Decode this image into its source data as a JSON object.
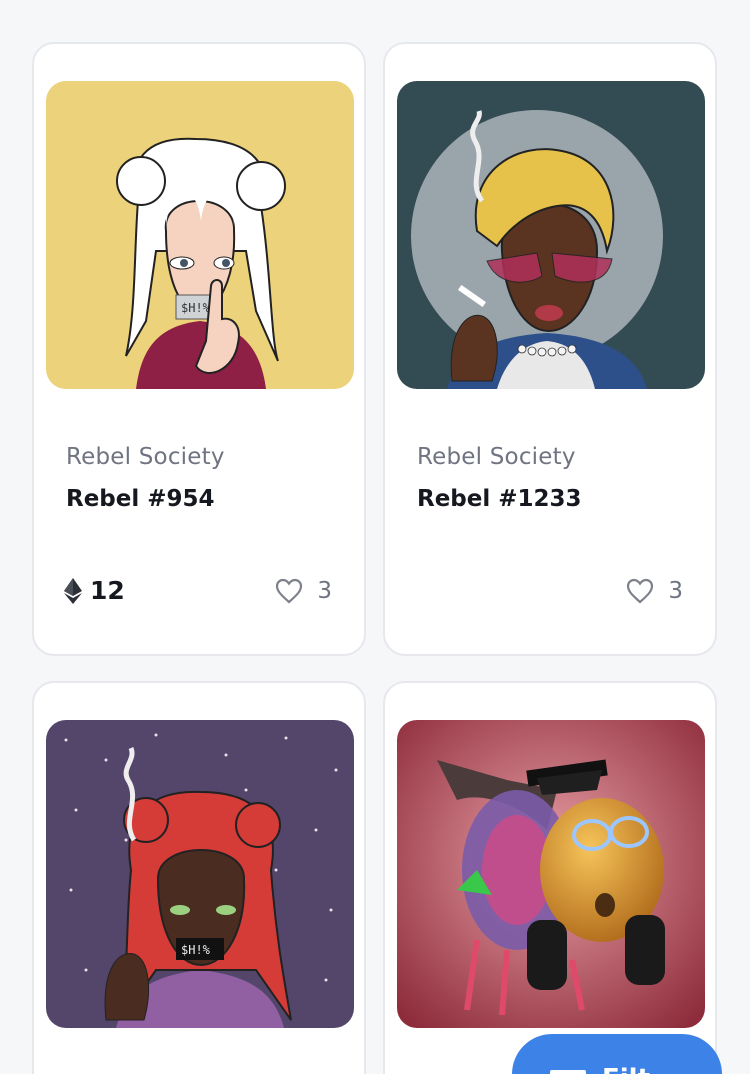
{
  "cards": [
    {
      "collection": "Rebel Society",
      "title": "Rebel #954",
      "price": "12",
      "likes": "3",
      "bg": "#ecd27a"
    },
    {
      "collection": "Rebel Society",
      "title": "Rebel #1233",
      "price": "",
      "likes": "3",
      "bg": "#334b52"
    },
    {
      "collection": "",
      "title": "",
      "price": "",
      "likes": "",
      "bg": "#54456b"
    },
    {
      "collection": "",
      "title": "",
      "price": "",
      "likes": "",
      "bg": "#a23d4d"
    }
  ],
  "filter_button": {
    "label": "Filt",
    "color": "#3d82e6"
  },
  "icons": {
    "price": "ethereum-icon",
    "likes": "heart-icon",
    "filter": "filter-icon"
  }
}
